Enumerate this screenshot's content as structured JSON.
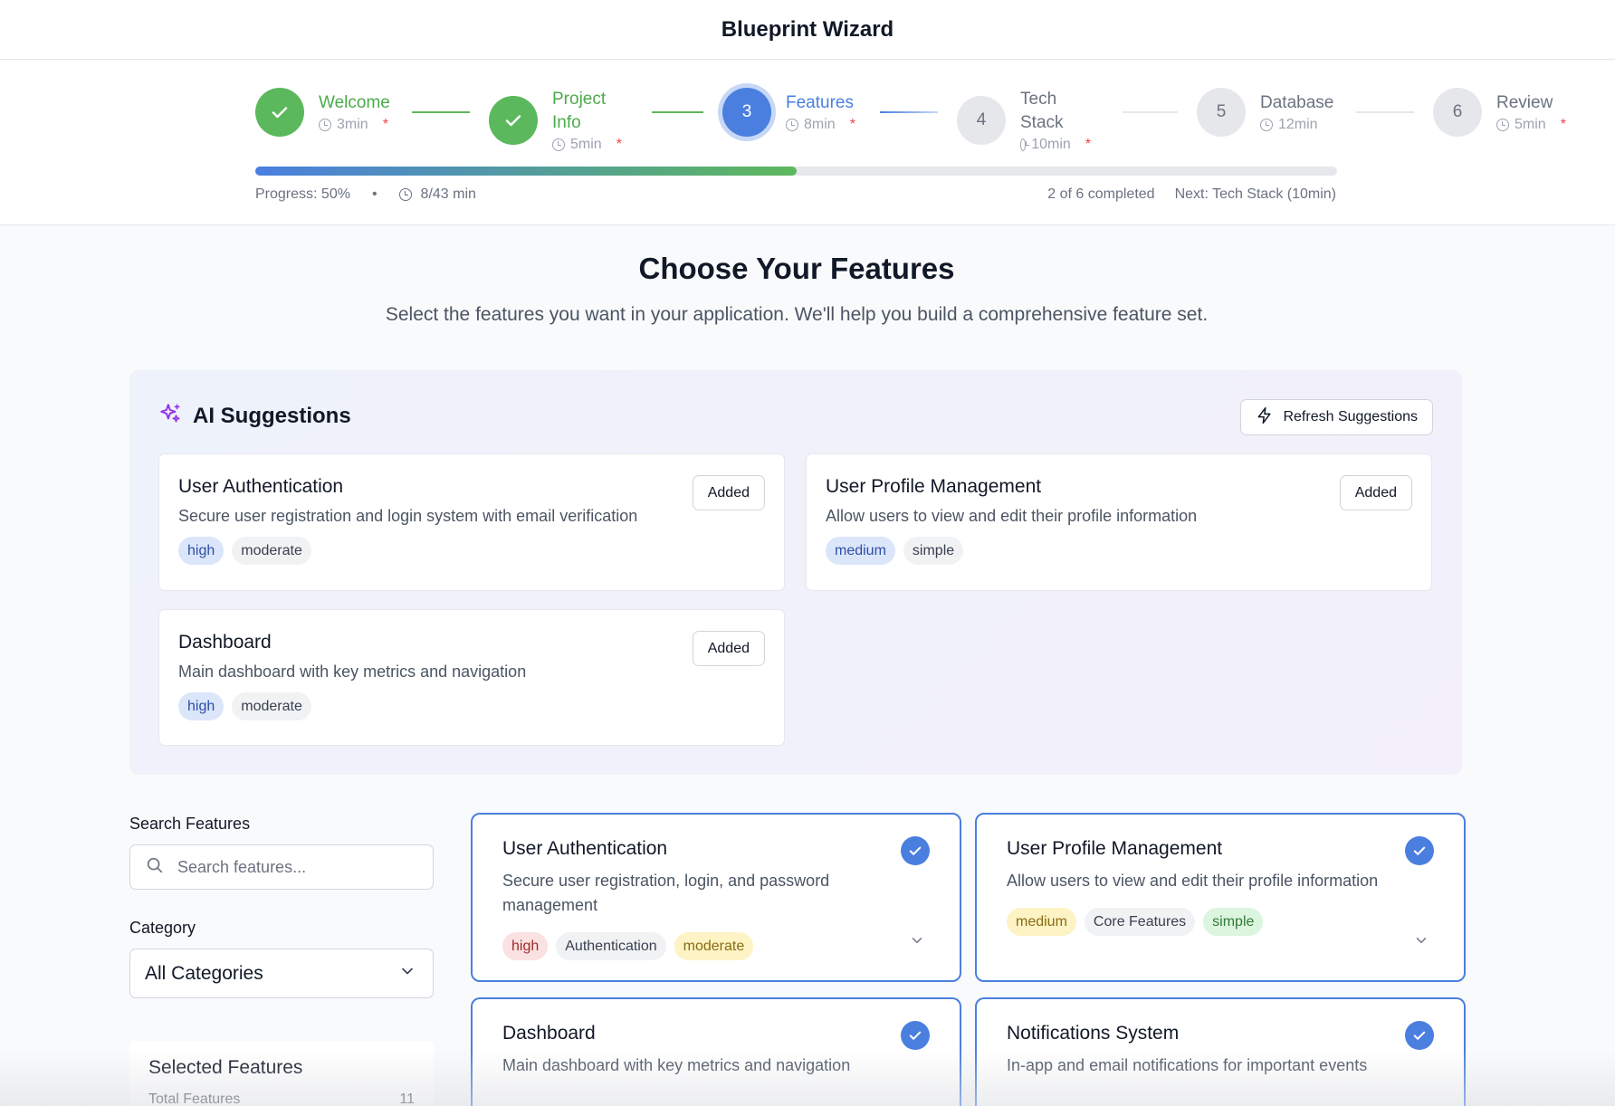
{
  "app": {
    "title": "Blueprint Wizard"
  },
  "steps": [
    {
      "number": "1",
      "label": "Welcome",
      "time": "3min",
      "status": "done",
      "required": "*"
    },
    {
      "number": "2",
      "label": "Project Info",
      "time": "5min",
      "status": "done",
      "required": "*"
    },
    {
      "number": "3",
      "label": "Features",
      "time": "8min",
      "status": "current",
      "required": "*"
    },
    {
      "number": "4",
      "label": "Tech Stack",
      "time": "10min",
      "status": "todo",
      "required": "*"
    },
    {
      "number": "5",
      "label": "Database",
      "time": "12min",
      "status": "todo",
      "required": ""
    },
    {
      "number": "6",
      "label": "Review",
      "time": "5min",
      "status": "todo",
      "required": "*"
    }
  ],
  "progress": {
    "percent": 50,
    "label": "Progress: 50%",
    "separator": "•",
    "time": "8/43 min",
    "completed": "2 of 6 completed",
    "next": "Next: Tech Stack (10min)"
  },
  "main": {
    "title": "Choose Your Features",
    "subtitle": "Select the features you want in your application. We'll help you build a comprehensive feature set."
  },
  "ai": {
    "title": "AI Suggestions",
    "refresh_label": "Refresh Suggestions",
    "suggestions": [
      {
        "title": "User Authentication",
        "desc": "Secure user registration and login system with email verification",
        "priority": "high",
        "complexity": "moderate",
        "action": "Added"
      },
      {
        "title": "User Profile Management",
        "desc": "Allow users to view and edit their profile information",
        "priority": "medium",
        "complexity": "simple",
        "action": "Added"
      },
      {
        "title": "Dashboard",
        "desc": "Main dashboard with key metrics and navigation",
        "priority": "high",
        "complexity": "moderate",
        "action": "Added"
      }
    ]
  },
  "filters": {
    "search_label": "Search Features",
    "search_placeholder": "Search features...",
    "category_label": "Category",
    "category_value": "All Categories"
  },
  "selected": {
    "title": "Selected Features",
    "total_label": "Total Features",
    "total_value": "11"
  },
  "features": [
    {
      "title": "User Authentication",
      "desc": "Secure user registration, login, and password management",
      "priority": "high",
      "category": "Authentication",
      "complexity": "moderate"
    },
    {
      "title": "User Profile Management",
      "desc": "Allow users to view and edit their profile information",
      "priority": "medium",
      "category": "Core Features",
      "complexity": "simple"
    },
    {
      "title": "Dashboard",
      "desc": "Main dashboard with key metrics and navigation",
      "priority": "",
      "category": "",
      "complexity": ""
    },
    {
      "title": "Notifications System",
      "desc": "In-app and email notifications for important events",
      "priority": "",
      "category": "",
      "complexity": ""
    }
  ],
  "colors": {
    "done": "#5cb85c",
    "current": "#4a7fe0",
    "todo": "#e5e7eb",
    "accent": "#4a7fe0"
  }
}
